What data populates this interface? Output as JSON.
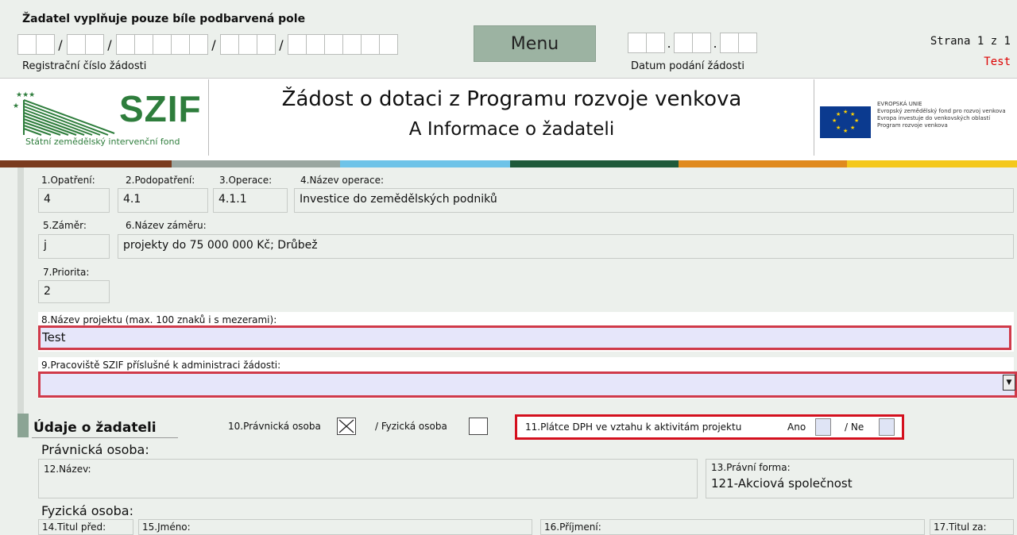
{
  "instruction": "Žadatel vyplňuje pouze bíle podbarvená pole",
  "registration": {
    "label": "Registrační číslo žádosti",
    "separator": "/"
  },
  "menu_label": "Menu",
  "date": {
    "label": "Datum podání žádosti",
    "separator": "."
  },
  "page_info": "Strana 1 z 1",
  "status": "Test",
  "logo": {
    "name": "SZIF",
    "subtitle": "Státní zemědělský intervenční fond"
  },
  "title": {
    "line1": "Žádost o dotaci z Programu rozvoje venkova",
    "line2": "A Informace o žadateli"
  },
  "eu": {
    "line1": "EVROPSKÁ UNIE",
    "line2": "Evropský zemědělský fond pro rozvoj venkova",
    "line3": "Evropa investuje do venkovských oblastí",
    "line4": "Program rozvoje venkova"
  },
  "colors": {
    "accent_red": "#d03a4a",
    "input_blue": "#e6e6fa",
    "menu_bg": "#9cb3a2",
    "brand_green": "#2e7d3c"
  },
  "fields": {
    "opatreni": {
      "label": "1.Opatření:",
      "value": "4"
    },
    "podopatreni": {
      "label": "2.Podopatření:",
      "value": "4.1"
    },
    "operace": {
      "label": "3.Operace:",
      "value": "4.1.1"
    },
    "nazev_operace": {
      "label": "4.Název operace:",
      "value": "Investice do zemědělských podniků"
    },
    "zamer": {
      "label": "5.Záměr:",
      "value": "j"
    },
    "nazev_zameru": {
      "label": "6.Název záměru:",
      "value": "projekty do 75 000 000 Kč; Drůbež"
    },
    "priorita": {
      "label": "7.Priorita:",
      "value": "2"
    },
    "nazev_projektu": {
      "label": "8.Název projektu (max. 100 znaků i s mezerami):",
      "value": "Test"
    },
    "pracoviste": {
      "label": "9.Pracoviště SZIF příslušné k administraci žádosti:",
      "value": ""
    }
  },
  "applicant": {
    "section_title": "Údaje o žadateli",
    "pravnicka_label": "10.Právnická osoba",
    "fyzicka_label": "/ Fyzická osoba",
    "pravnicka_checked": true,
    "dph_label": "11.Plátce DPH ve vztahu k aktivitám projektu",
    "ano_label": "Ano",
    "ne_label": "/ Ne",
    "legal_heading": "Právnická osoba:",
    "nazev_label": "12.Název:",
    "pravni_forma_label": "13.Právní forma:",
    "pravni_forma_value": "121-Akciová společnost",
    "natural_heading": "Fyzická osoba:",
    "titul_pred_label": "14.Titul před:",
    "jmeno_label": "15.Jméno:",
    "prijmeni_label": "16.Příjmení:",
    "titul_za_label": "17.Titul za:"
  }
}
